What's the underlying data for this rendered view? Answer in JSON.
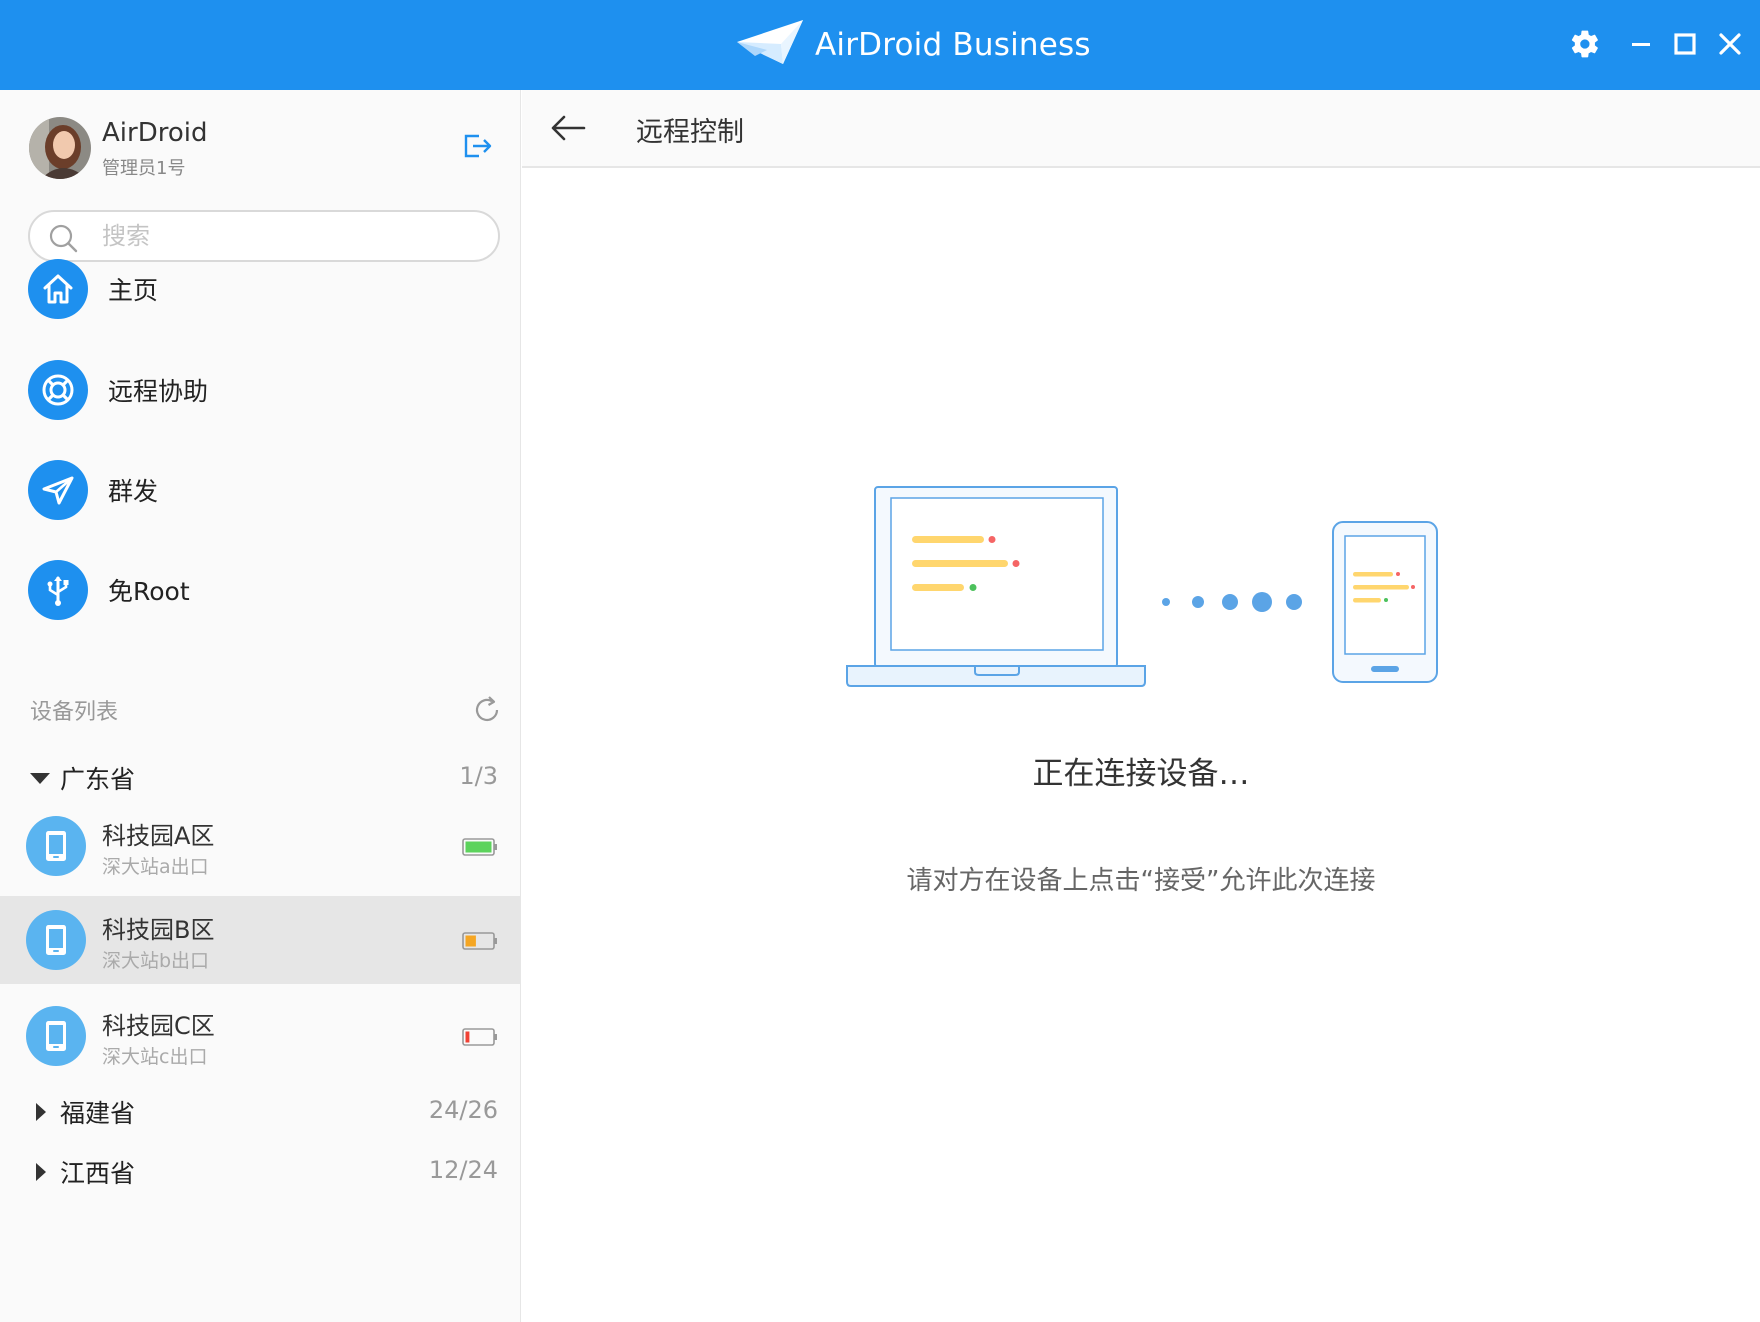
{
  "app": {
    "title": "AirDroid Business"
  },
  "colors": {
    "brand": "#1e90ef",
    "device_icon": "#5ab4f0",
    "selected_row": "#e6e6e6"
  },
  "user": {
    "name": "AirDroid",
    "role": "管理员1号"
  },
  "search": {
    "placeholder": "搜索"
  },
  "nav": [
    {
      "label": "主页",
      "icon": "home-icon"
    },
    {
      "label": "远程协助",
      "icon": "lifebuoy-icon"
    },
    {
      "label": "群发",
      "icon": "send-icon"
    },
    {
      "label": "免Root",
      "icon": "usb-icon"
    }
  ],
  "device_list": {
    "title": "设备列表",
    "groups": [
      {
        "name": "广东省",
        "count": "1/3",
        "expanded": true,
        "devices": [
          {
            "name": "科技园A区",
            "location": "深大站a出口",
            "battery_level": 1.0,
            "battery_color": "#5cd35c",
            "selected": false
          },
          {
            "name": "科技园B区",
            "location": "深大站b出口",
            "battery_level": 0.4,
            "battery_color": "#f5a623",
            "selected": true
          },
          {
            "name": "科技园C区",
            "location": "深大站c出口",
            "battery_level": 0.15,
            "battery_color": "#f04134",
            "selected": false
          }
        ]
      },
      {
        "name": "福建省",
        "count": "24/26",
        "expanded": false
      },
      {
        "name": "江西省",
        "count": "12/24",
        "expanded": false
      }
    ]
  },
  "main": {
    "title": "远程控制",
    "status": "正在连接设备…",
    "hint": "请对方在设备上点击“接受”允许此次连接"
  }
}
